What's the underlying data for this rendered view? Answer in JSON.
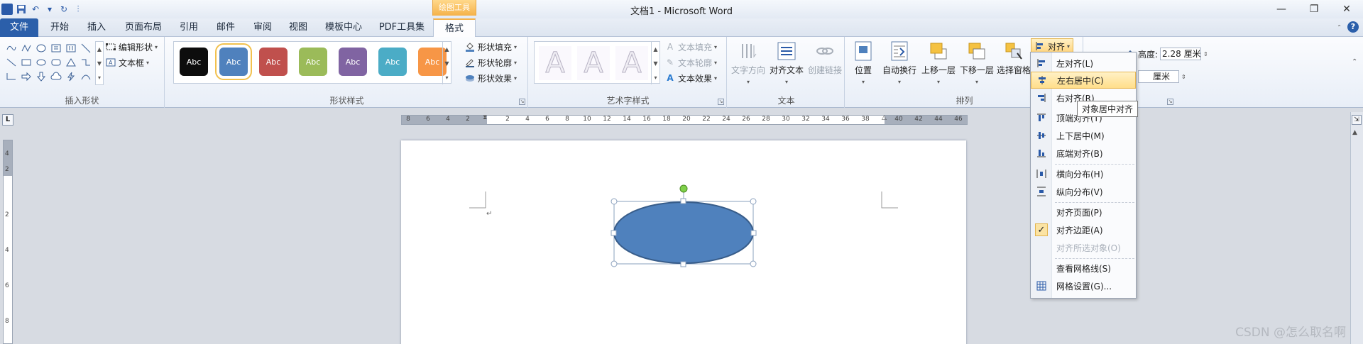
{
  "window": {
    "title": "文档1 - Microsoft Word"
  },
  "context_group": {
    "label": "绘图工具"
  },
  "tabs": [
    {
      "label": "文件"
    },
    {
      "label": "开始"
    },
    {
      "label": "插入"
    },
    {
      "label": "页面布局"
    },
    {
      "label": "引用"
    },
    {
      "label": "邮件"
    },
    {
      "label": "审阅"
    },
    {
      "label": "视图"
    },
    {
      "label": "模板中心"
    },
    {
      "label": "PDF工具集"
    },
    {
      "label": "格式"
    }
  ],
  "ribbon": {
    "insert_shapes": {
      "label": "插入形状",
      "edit_shape": "编辑形状",
      "text_box": "文本框"
    },
    "shape_styles": {
      "label": "形状样式",
      "items": [
        {
          "text": "Abc",
          "color": "#0d0d0d"
        },
        {
          "text": "Abc",
          "color": "#4f81bd"
        },
        {
          "text": "Abc",
          "color": "#c0504d"
        },
        {
          "text": "Abc",
          "color": "#9bbb59"
        },
        {
          "text": "Abc",
          "color": "#8064a2"
        },
        {
          "text": "Abc",
          "color": "#4bacc6"
        },
        {
          "text": "Abc",
          "color": "#f79646"
        }
      ],
      "fill": "形状填充",
      "outline": "形状轮廓",
      "effects": "形状效果"
    },
    "wordart": {
      "label": "艺术字样式",
      "items": [
        "A",
        "A",
        "A"
      ],
      "text_fill": "文本填充",
      "text_outline": "文本轮廓",
      "text_effects": "文本效果"
    },
    "text": {
      "label": "文本",
      "direction": "文字方向",
      "align_text": "对齐文本",
      "create_link": "创建链接"
    },
    "arrange": {
      "label": "排列",
      "position": "位置",
      "wrap": "自动换行",
      "bring_forward": "上移一层",
      "send_backward": "下移一层",
      "selection_pane": "选择窗格",
      "align": "对齐"
    },
    "size": {
      "height_label": "高度:",
      "height_value": "2.28 厘米",
      "width_value": "厘米"
    }
  },
  "ruler": {
    "numbers": [
      "8",
      "6",
      "4",
      "2",
      "2",
      "4",
      "6",
      "8",
      "10",
      "12",
      "14",
      "16",
      "18",
      "20",
      "22",
      "24",
      "26",
      "28",
      "30",
      "32",
      "34",
      "36",
      "38",
      "40",
      "42",
      "44",
      "46",
      "48"
    ]
  },
  "vruler": {
    "numbers": [
      "4",
      "2",
      "2",
      "4",
      "6",
      "8"
    ]
  },
  "align_menu": {
    "items": [
      {
        "label": "左对齐(L)",
        "icon": "align-left-icon"
      },
      {
        "label": "左右居中(C)",
        "icon": "align-center-icon"
      },
      {
        "label": "右对齐(R)",
        "icon": "align-right-icon"
      },
      {
        "label": "顶端对齐(T)",
        "icon": "align-top-icon"
      },
      {
        "label": "上下居中(M)",
        "icon": "align-middle-icon"
      },
      {
        "label": "底端对齐(B)",
        "icon": "align-bottom-icon"
      },
      {
        "label": "横向分布(H)",
        "icon": "distribute-horizontal-icon"
      },
      {
        "label": "纵向分布(V)",
        "icon": "distribute-vertical-icon"
      },
      {
        "label": "对齐页面(P)",
        "icon": ""
      },
      {
        "label": "对齐边距(A)",
        "icon": "check-icon"
      },
      {
        "label": "对齐所选对象(O)",
        "icon": ""
      },
      {
        "label": "查看网格线(S)",
        "icon": ""
      },
      {
        "label": "网格设置(G)...",
        "icon": "grid-icon"
      }
    ],
    "tooltip": "对象居中对齐"
  },
  "watermark": "CSDN @怎么取名啊"
}
